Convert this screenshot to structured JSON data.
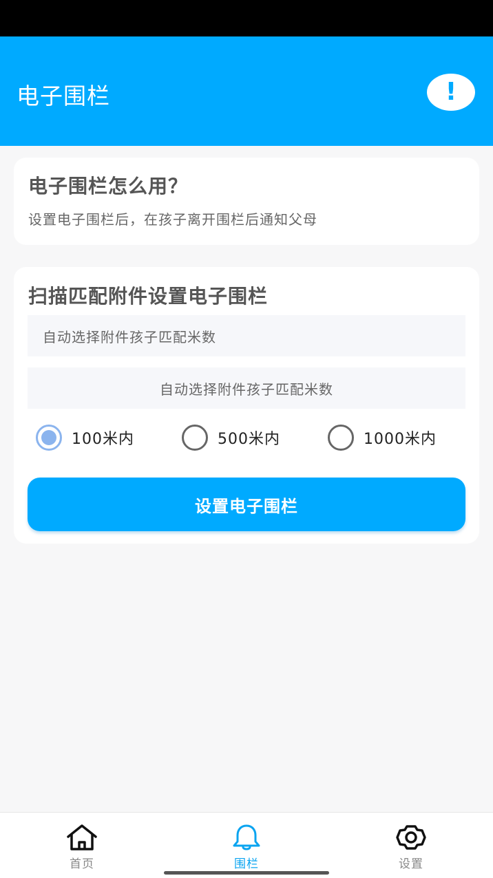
{
  "app_bar": {
    "title": "电子围栏",
    "info_icon": "exclamation-icon",
    "info_glyph": "!"
  },
  "intro_card": {
    "title": "电子围栏怎么用？",
    "description": "设置电子围栏后，在孩子离开围栏后通知父母"
  },
  "setup_card": {
    "title": "扫描匹配附件设置电子围栏",
    "field_1_text": "自动选择附件孩子匹配米数",
    "field_2_text": "自动选择附件孩子匹配米数",
    "radius_options": [
      {
        "label": "100米内",
        "checked": true
      },
      {
        "label": "500米内",
        "checked": false
      },
      {
        "label": "1000米内",
        "checked": false
      }
    ],
    "submit_label": "设置电子围栏"
  },
  "bottom_nav": {
    "items": [
      {
        "label": "首页",
        "icon": "home-icon",
        "active": false
      },
      {
        "label": "围栏",
        "icon": "bell-icon",
        "active": true
      },
      {
        "label": "设置",
        "icon": "gear-icon",
        "active": false
      }
    ]
  },
  "colors": {
    "accent": "#00aaff",
    "radio_checked": "#8bb4ee",
    "background": "#f7f7f8"
  }
}
